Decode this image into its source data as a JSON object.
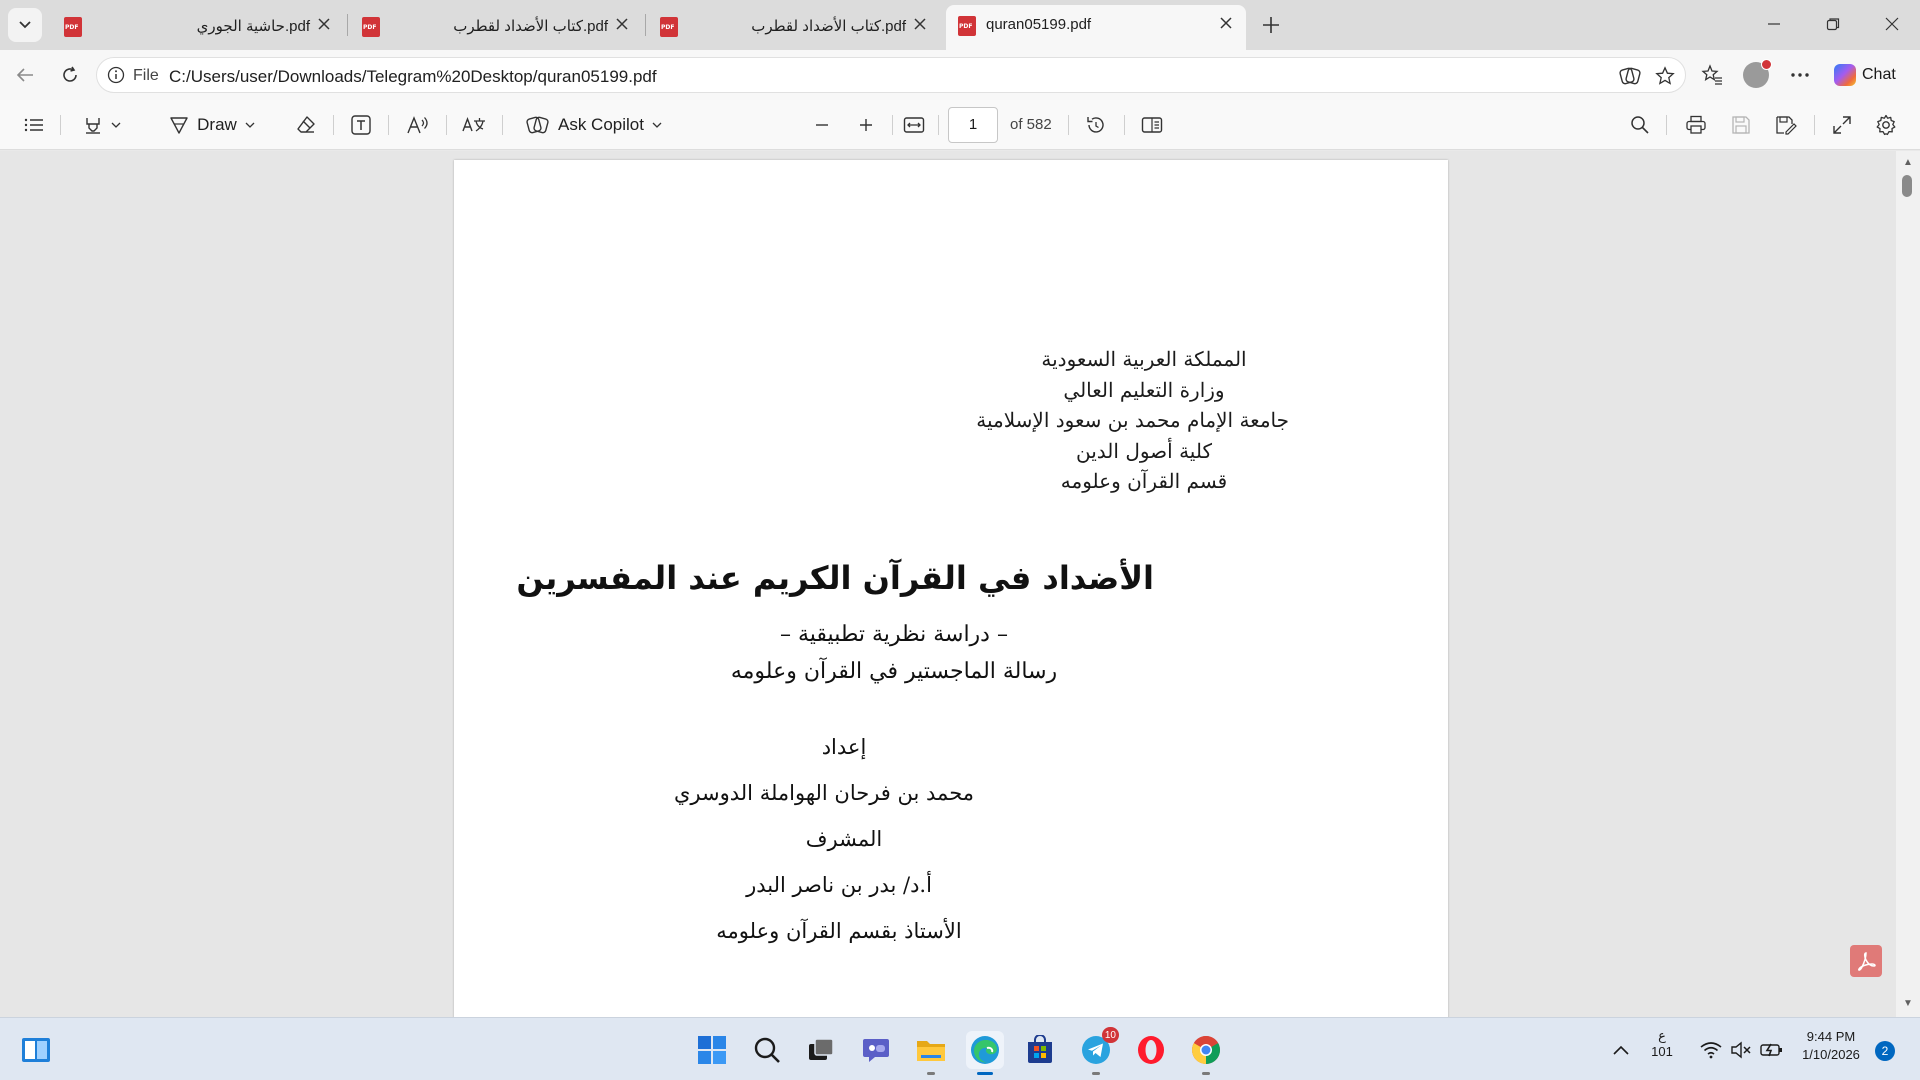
{
  "tabs": [
    {
      "title": "حاشية الجوري.pdf",
      "active": false
    },
    {
      "title": "كتاب الأضداد لقطرب.pdf",
      "active": false
    },
    {
      "title": "كتاب الأضداد لقطرب.pdf",
      "active": false
    },
    {
      "title": "quran05199.pdf",
      "active": true
    }
  ],
  "address": {
    "scheme_label": "File",
    "url": "C:/Users/user/Downloads/Telegram%20Desktop/quran05199.pdf",
    "chat_label": "Chat"
  },
  "pdf_toolbar": {
    "draw_label": "Draw",
    "copilot_label": "Ask Copilot",
    "page_number": "1",
    "page_total": "of 582"
  },
  "document": {
    "header_lines": [
      "المملكة العربية السعودية",
      "وزارة التعليم العالي",
      "جامعة الإمام محمد بن سعود الإسلامية",
      "كلية أصول الدين",
      "قسم القرآن وعلومه"
    ],
    "title": "الأضداد في القرآن الكريم عند المفسرين",
    "subtitle": "– دراسة نظرية تطبيقية –",
    "degree": "رسالة الماجستير في القرآن وعلومه",
    "prepared_label": "إعداد",
    "author": "محمد بن فرحان الهواملة الدوسري",
    "supervisor_label": "المشرف",
    "supervisor": "أ.د/ بدر بن ناصر البدر",
    "supervisor_title": "الأستاذ بقسم القرآن وعلومه"
  },
  "taskbar": {
    "telegram_badge": "10",
    "input_lang": "ع",
    "input_code": "101",
    "time": "9:44 PM",
    "date": "1/10/2026",
    "notification_count": "2"
  }
}
